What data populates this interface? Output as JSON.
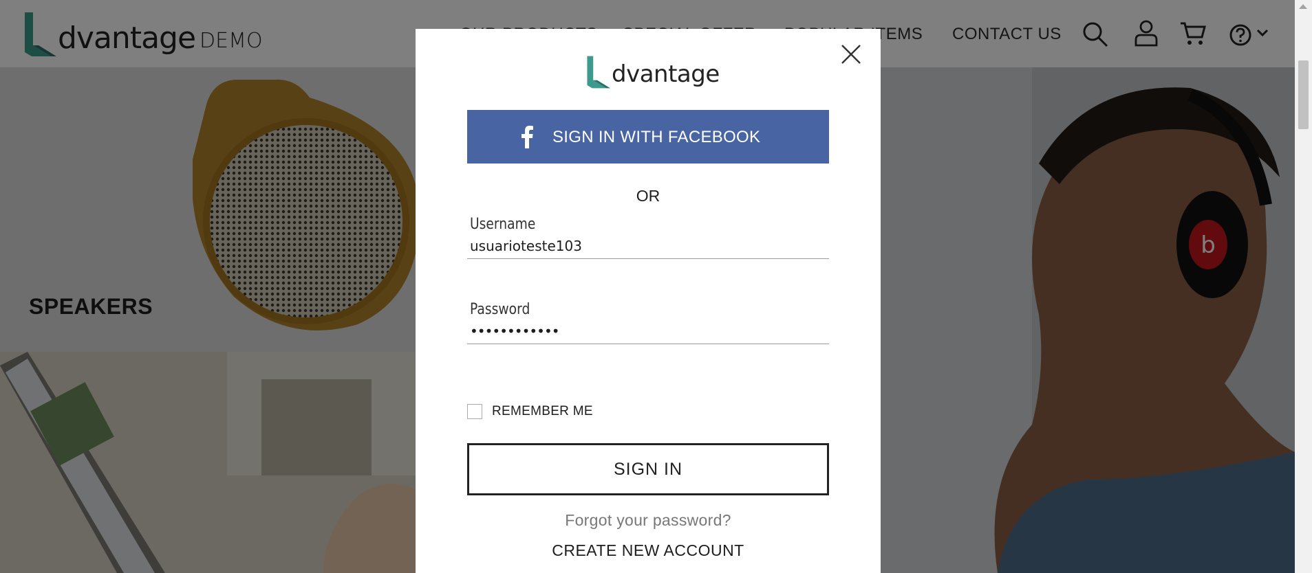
{
  "header": {
    "logo_text": "dvantage",
    "logo_suffix": "DEMO",
    "nav": [
      "OUR PRODUCTS",
      "SPECIAL OFFER",
      "POPULAR ITEMS",
      "CONTACT US"
    ],
    "icons": [
      "search-icon",
      "user-icon",
      "cart-icon",
      "help-icon",
      "chevron-down-icon"
    ]
  },
  "hero": {
    "speakers_label": "SPEAKERS"
  },
  "modal": {
    "logo_text": "dvantage",
    "facebook_label": "SIGN IN WITH FACEBOOK",
    "or_text": "OR",
    "username": {
      "label": "Username",
      "value": "usuarioteste103"
    },
    "password": {
      "label": "Password",
      "value": "••••••••••••"
    },
    "remember_label": "REMEMBER ME",
    "remember_checked": false,
    "signin_label": "SIGN IN",
    "forgot_label": "Forgot your password?",
    "create_label": "CREATE NEW ACCOUNT"
  },
  "colors": {
    "brand_teal": "#3d9a8c",
    "facebook_blue": "#4864a3",
    "overlay": "rgba(0,0,0,0.5)"
  }
}
